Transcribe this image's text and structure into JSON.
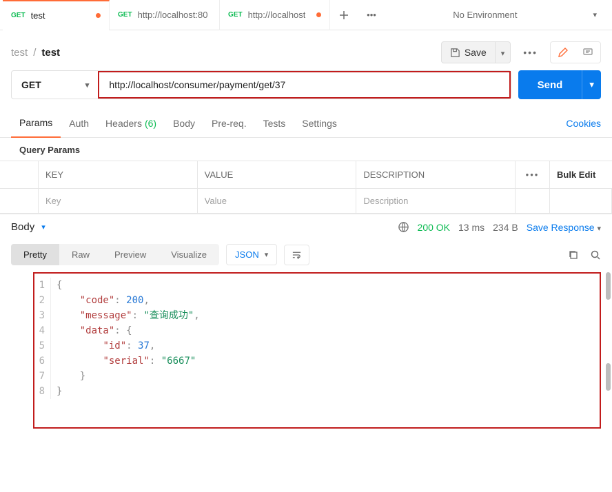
{
  "tabs": [
    {
      "method": "GET",
      "title": "test",
      "modified": true
    },
    {
      "method": "GET",
      "title": "http://localhost:80",
      "modified": false
    },
    {
      "method": "GET",
      "title": "http://localhost",
      "modified": true
    }
  ],
  "environment": "No Environment",
  "breadcrumb": {
    "collection": "test",
    "name": "test"
  },
  "save_label": "Save",
  "request": {
    "method": "GET",
    "url": "http://localhost/consumer/payment/get/37",
    "send_label": "Send"
  },
  "request_tabs": {
    "params": "Params",
    "auth": "Auth",
    "headers": "Headers",
    "headers_count": "(6)",
    "body": "Body",
    "prereq": "Pre-req.",
    "tests": "Tests",
    "settings": "Settings",
    "cookies": "Cookies"
  },
  "query_params": {
    "title": "Query Params",
    "columns": {
      "key": "KEY",
      "value": "VALUE",
      "desc": "DESCRIPTION"
    },
    "bulk_edit": "Bulk Edit",
    "placeholders": {
      "key": "Key",
      "value": "Value",
      "desc": "Description"
    }
  },
  "response": {
    "body_label": "Body",
    "status_code": "200 OK",
    "time": "13 ms",
    "size": "234 B",
    "save_label": "Save Response",
    "view_tabs": {
      "pretty": "Pretty",
      "raw": "Raw",
      "preview": "Preview",
      "visualize": "Visualize"
    },
    "format": "JSON",
    "lines": [
      [
        {
          "t": "{",
          "c": "p"
        }
      ],
      [
        {
          "t": "    ",
          "c": ""
        },
        {
          "t": "\"code\"",
          "c": "k"
        },
        {
          "t": ": ",
          "c": "p"
        },
        {
          "t": "200",
          "c": "num"
        },
        {
          "t": ",",
          "c": "p"
        }
      ],
      [
        {
          "t": "    ",
          "c": ""
        },
        {
          "t": "\"message\"",
          "c": "k"
        },
        {
          "t": ": ",
          "c": "p"
        },
        {
          "t": "\"查询成功\"",
          "c": "str"
        },
        {
          "t": ",",
          "c": "p"
        }
      ],
      [
        {
          "t": "    ",
          "c": ""
        },
        {
          "t": "\"data\"",
          "c": "k"
        },
        {
          "t": ": ",
          "c": "p"
        },
        {
          "t": "{",
          "c": "p"
        }
      ],
      [
        {
          "t": "        ",
          "c": ""
        },
        {
          "t": "\"id\"",
          "c": "k"
        },
        {
          "t": ": ",
          "c": "p"
        },
        {
          "t": "37",
          "c": "num"
        },
        {
          "t": ",",
          "c": "p"
        }
      ],
      [
        {
          "t": "        ",
          "c": ""
        },
        {
          "t": "\"serial\"",
          "c": "k"
        },
        {
          "t": ": ",
          "c": "p"
        },
        {
          "t": "\"6667\"",
          "c": "str"
        }
      ],
      [
        {
          "t": "    ",
          "c": ""
        },
        {
          "t": "}",
          "c": "p"
        }
      ],
      [
        {
          "t": "}",
          "c": "p"
        }
      ]
    ]
  }
}
